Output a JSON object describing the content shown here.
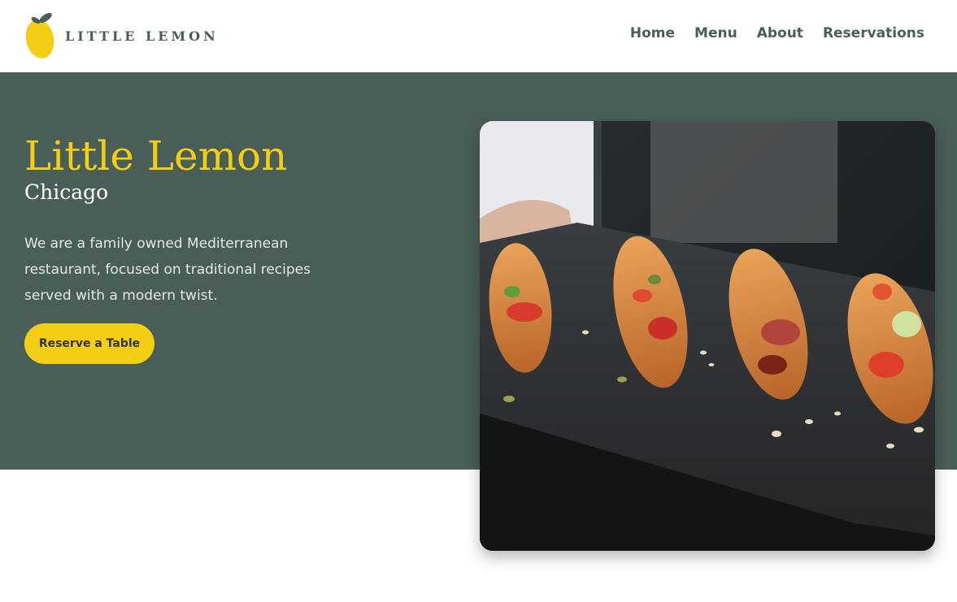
{
  "brand": {
    "name": "LITTLE LEMON",
    "logo_icon": "lemon-icon",
    "colors": {
      "primary_green": "#495e57",
      "accent_yellow": "#f4ce14"
    }
  },
  "nav": {
    "items": [
      {
        "label": "Home"
      },
      {
        "label": "Menu"
      },
      {
        "label": "About"
      },
      {
        "label": "Reservations"
      }
    ]
  },
  "hero": {
    "title": "Little Lemon",
    "subtitle": "Chicago",
    "description": "We are a family owned Mediterranean restaurant, focused on traditional recipes served with a modern twist.",
    "cta_label": "Reserve a Table",
    "image_subject": "bruschetta-on-slate-photo"
  }
}
